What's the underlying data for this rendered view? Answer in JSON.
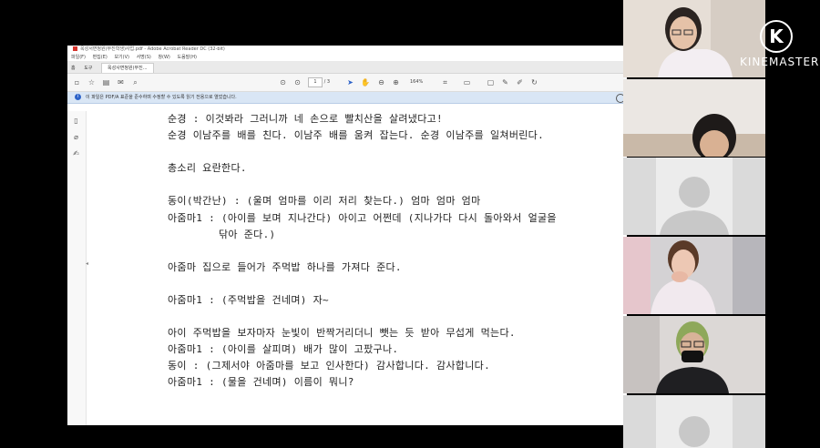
{
  "pdf_window": {
    "title": "옥성서면청원(무진학생)사업.pdf - Adobe Acrobat Reader DC (32-bit)",
    "menu": [
      "파일(F)",
      "편집(E)",
      "보기(V)",
      "서명(S)",
      "창(W)",
      "도움말(H)"
    ],
    "tabs": {
      "home": "홈",
      "tools": "도구",
      "document": "옥성사면청원(무진..."
    },
    "toolbar": {
      "page_current": "1",
      "page_total": "/ 3",
      "zoom": "164%"
    },
    "info_bar": "이 파일은 PDF/A 표준을 준수하며 수정할 수 있도록 읽기 전용으로 열었습니다."
  },
  "document_lines": [
    {
      "text": "순경 : 이것봐라 그러니까 네 손으로 빨치산을 살려냈다고!",
      "indent": false
    },
    {
      "text": "순경 이남주를 배를 친다. 이남주 배를 움켜 잡는다. 순경 이남주를 일쳐버린다.",
      "indent": false
    },
    {
      "text": "총소리 요란한다.",
      "indent": false
    },
    {
      "text": "동이(박간난) : (울며 엄마를 이리 저리 찾는다.) 엄마 엄마 엄마",
      "indent": false
    },
    {
      "text": "아줌마1 : (아이를 보며 지나간다) 아이고 어쩐데 (지나가다 다시 돌아와서 얼굴을",
      "indent": false
    },
    {
      "text": "닦아 준다.)",
      "indent": true
    },
    {
      "text": "아줌마 집으로 들어가 주먹밥 하나를 가져다 준다.",
      "indent": false
    },
    {
      "text": "아줌마1 : (주먹밥을 건네며) 자~",
      "indent": false
    },
    {
      "text": "아이 주먹밥을 보자마자 눈빛이 반짝거리더니 뺏는 듯 받아 무섭게 먹는다.",
      "indent": false
    },
    {
      "text": "아줌마1 : (아이를 살피며) 배가 많이 고팠구나.",
      "indent": false
    },
    {
      "text": "동이 : (그제서야 아줌마를 보고 인사한다) 감사합니다. 감사합니다.",
      "indent": false
    },
    {
      "text": "아줌마1 : (물을 건네며) 이름이 뭐니?",
      "indent": false
    }
  ],
  "watermark": {
    "text": "KINEMASTER",
    "logo": "K"
  },
  "colors": {
    "accent_blue": "#2c62c8",
    "info_bg": "#d9e6f5"
  }
}
